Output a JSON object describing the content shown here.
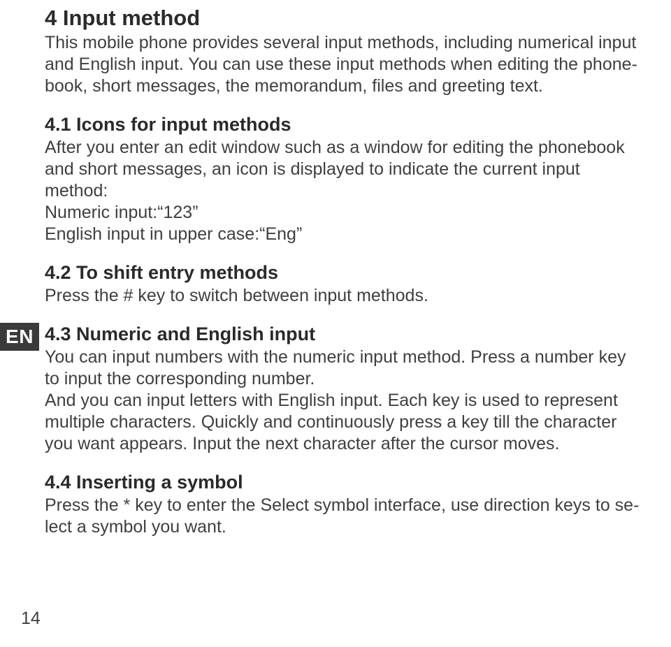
{
  "title": "4 Input method",
  "intro": "This mobile phone provides several input methods, including numerical input and English input. You can use these input methods when editing the phone-book, short messages, the memorandum, files and greeting text.",
  "sec41": {
    "heading": "4.1 Icons for input methods",
    "body1": "After you enter an edit window such as a window for editing the phonebook and short messages, an icon is displayed to indicate the current input method:",
    "body2": "Numeric input:“123”",
    "body3": "English input in upper case:“Eng”"
  },
  "sec42": {
    "heading": "4.2 To shift entry methods",
    "body": "Press the # key to switch between input methods."
  },
  "sec43": {
    "heading": "4.3 Numeric and English input",
    "body1": "You can input numbers with the numeric input method. Press a number key to input the corresponding number.",
    "body2": "And you can input letters with English input. Each key is used to represent multiple characters. Quickly and continuously press a key till the character you want appears. Input the next character after the cursor moves."
  },
  "sec44": {
    "heading": "4.4 Inserting a symbol",
    "body": "Press the * key to enter the Select symbol interface, use direction keys to se-lect a symbol you want."
  },
  "langTab": "EN",
  "pageNumber": "14"
}
